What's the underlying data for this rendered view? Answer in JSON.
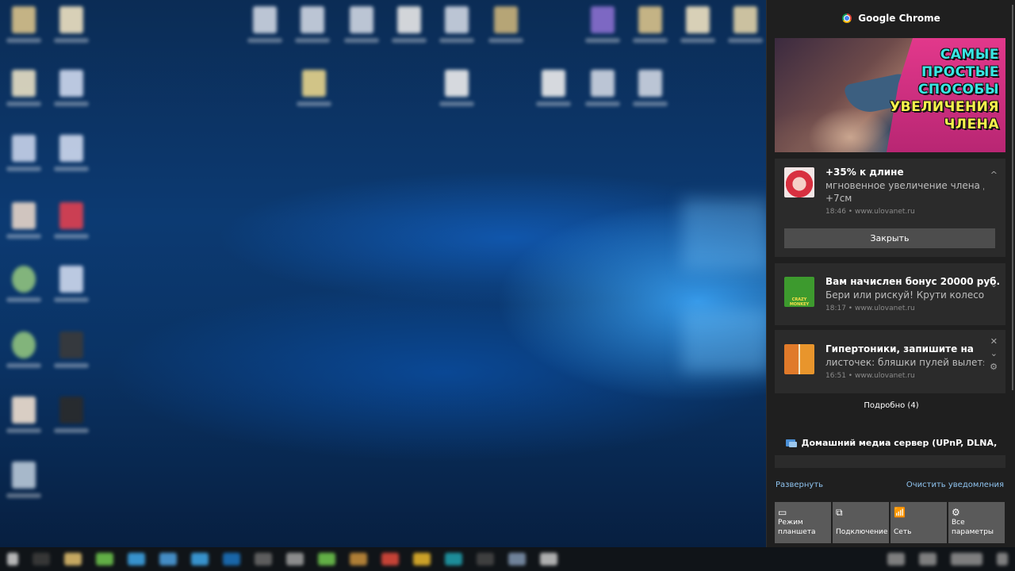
{
  "action_center": {
    "app_name": "Google Chrome",
    "banner_lines": [
      "САМЫЕ",
      "ПРОСТЫЕ",
      "СПОСОБЫ",
      "УВЕЛИЧЕНИЯ",
      "ЧЛЕНА"
    ],
    "notifications": [
      {
        "title": "+35% к длине",
        "body_line1": "мгновенное увеличение члена до",
        "body_line2": "+7см",
        "meta": "18:46 • www.ulovanet.ru",
        "button": "Закрыть",
        "control": "^"
      },
      {
        "title": "Вам начислен бонус 20000 руб.",
        "body_line1": "Бери или рискуй! Крути колесо фор",
        "meta": "18:17 • www.ulovanet.ru",
        "control": "⌄",
        "thumb_text": "CRAZY MONKEY"
      },
      {
        "title": "Гипертоники, запишите на",
        "body_line1": "листочек: бляшки пулей вылетят и в",
        "meta": "16:51 • www.ulovanet.ru",
        "controls": [
          "✕",
          "⌄",
          "⚙"
        ]
      }
    ],
    "more_label": "Подробно (4)",
    "media_server_title": "Домашний медиа сервер (UPnP, DLNA,",
    "expand_label": "Развернуть",
    "clear_label": "Очистить уведомления",
    "quick_actions": [
      {
        "icon": "tablet-mode-icon",
        "glyph": "▭",
        "line1": "Режим",
        "line2": "планшета"
      },
      {
        "icon": "connect-icon",
        "glyph": "⧉",
        "line1": "",
        "line2": "Подключение"
      },
      {
        "icon": "network-icon",
        "glyph": "📶",
        "line1": "",
        "line2": "Сеть"
      },
      {
        "icon": "settings-icon",
        "glyph": "⚙",
        "line1": "Все",
        "line2": "параметры"
      }
    ]
  },
  "colors": {
    "panel_bg": "#1f1f1f",
    "card_bg": "#2b2b2b",
    "link": "#8fc4f0",
    "tile": "#5a5a5a",
    "banner_cyan": "#39e7e4",
    "banner_pink": "#e2388b"
  }
}
